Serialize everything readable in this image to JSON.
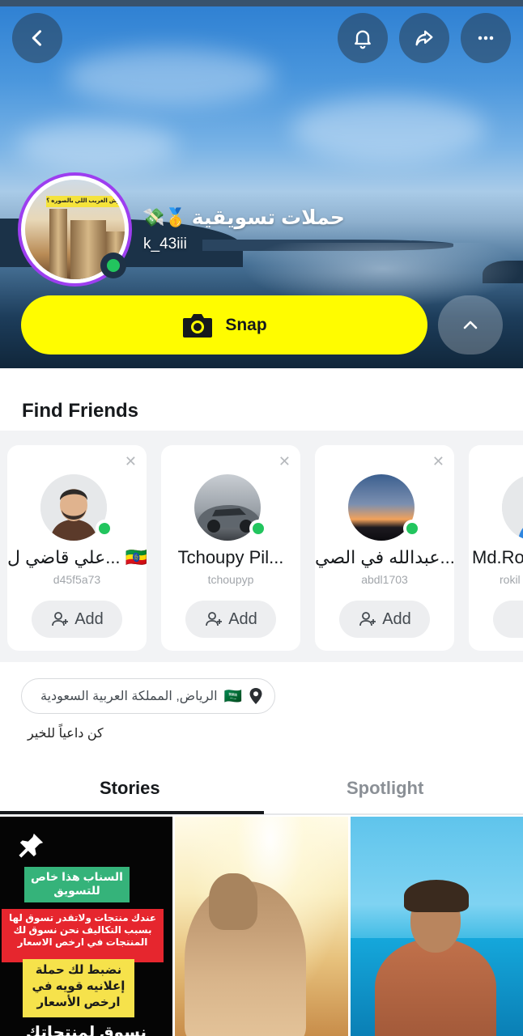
{
  "header": {
    "display_name": "حملات تسويقية",
    "name_emojis": "💸🥇",
    "username": "k_43iii",
    "avatar_banner_text": "وش الغريب اللي بالصوره ؟",
    "snap_button_label": "Snap",
    "icons": {
      "back": "chevron-left-icon",
      "notifications": "bell-icon",
      "share": "share-arrow-icon",
      "more": "more-horizontal-icon",
      "camera": "camera-icon",
      "collapse": "chevron-up-icon"
    }
  },
  "find_friends": {
    "title": "Find Friends",
    "add_label": "Add",
    "cards": [
      {
        "name": "علي قاضي ل... 🇪🇹",
        "username": "d45f5a73",
        "online": true
      },
      {
        "name": "Tchoupy Pil...",
        "username": "tchoupyp",
        "online": true
      },
      {
        "name": "عبدالله في الصي...",
        "username": "abdl1703",
        "online": true
      },
      {
        "name": "Md.Ro",
        "username": "rokil",
        "online": false
      }
    ]
  },
  "profile_info": {
    "location": "الرياض, المملكة العربية السعودية",
    "location_flag": "🇸🇦",
    "bio": "كن داعياً للخير"
  },
  "tabs": {
    "items": [
      "Stories",
      "Spotlight"
    ],
    "active": "Stories"
  },
  "stories": {
    "first_thumb": {
      "green_box": "السناب هذا خاص للتسويق",
      "red_box": "عندك منتجات ولاتقدر تسوق لها بسبب التكاليف نحن نسوق لك المنتجات في ارخص الاسعار",
      "yellow_box": "نضبط لك حملة إعلانيه قويه في ارخص الأسعار",
      "bottom_text": "نسوق لمنتجاتك"
    }
  },
  "colors": {
    "snap_yellow": "#fffc00",
    "online_green": "#22c55e",
    "avatar_ring": "#9d3ef0"
  }
}
